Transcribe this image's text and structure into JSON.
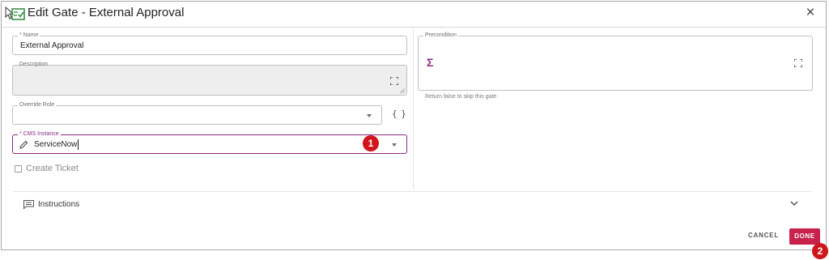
{
  "dialog": {
    "title": "Edit Gate - External Approval",
    "close_glyph": "×"
  },
  "form": {
    "name": {
      "label": "* Name",
      "value": "External Approval"
    },
    "description": {
      "label": "Description",
      "value": ""
    },
    "override_role": {
      "label": "Override Role",
      "value": ""
    },
    "override_role_expr_glyph": "{ }",
    "cms_instance": {
      "label": "* CMS Instance",
      "value": "ServiceNow"
    },
    "create_ticket": {
      "label": "Create Ticket",
      "checked": false
    }
  },
  "precondition": {
    "label": "Precondition",
    "sigma_glyph": "Σ",
    "hint": "Return false to skip this gate."
  },
  "instructions": {
    "label": "Instructions"
  },
  "actions": {
    "cancel": "CANCEL",
    "done": "DONE"
  },
  "markers": {
    "first": "1",
    "second": "2"
  },
  "colors": {
    "accent": "#8a2b86",
    "done_button": "#c8224c",
    "marker": "#d0161c"
  },
  "icons": [
    "checklist-icon",
    "close-icon",
    "expand-icon",
    "resize-grip-icon",
    "chevron-down-icon",
    "curly-braces-icon",
    "pencil-icon",
    "sigma-icon",
    "comment-icon"
  ]
}
